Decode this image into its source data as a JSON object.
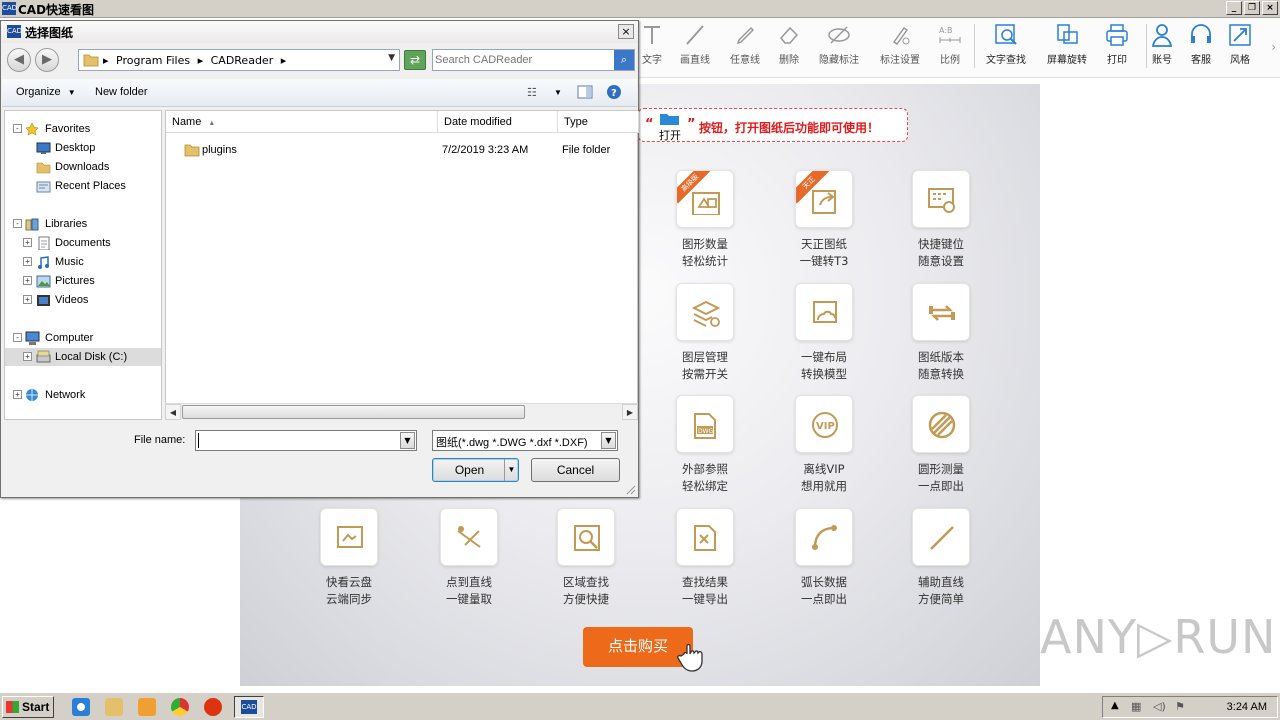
{
  "app": {
    "title": "CAD快速看图",
    "icon_label": "CAD"
  },
  "window_controls": {
    "minimize": "_",
    "restore": "❐",
    "close": "×"
  },
  "toolbar": [
    {
      "label": "文字",
      "icon": "text-icon"
    },
    {
      "label": "画直线",
      "icon": "line-icon"
    },
    {
      "label": "任意线",
      "icon": "pen-icon"
    },
    {
      "label": "删除",
      "icon": "eraser-icon"
    },
    {
      "label": "隐藏标注",
      "icon": "eye-hide-icon"
    },
    {
      "label": "标注设置",
      "icon": "annotation-settings-icon"
    },
    {
      "label": "比例",
      "icon": "scale-icon"
    },
    {
      "label": "文字查找",
      "icon": "text-search-icon"
    },
    {
      "label": "屏幕旋转",
      "icon": "screen-rotate-icon"
    },
    {
      "label": "打印",
      "icon": "printer-icon"
    },
    {
      "label": "账号",
      "icon": "account-icon"
    },
    {
      "label": "客服",
      "icon": "headset-icon"
    },
    {
      "label": "风格",
      "icon": "style-icon"
    }
  ],
  "hint": {
    "quote_open": "“",
    "quote_close": "”",
    "open_label": "打开",
    "text": "按钮，打开图纸后功能即可使用！"
  },
  "features": [
    {
      "line1": "图形数量",
      "line2": "轻松统计",
      "badge": "高级版",
      "icon": "shape-count-icon"
    },
    {
      "line1": "天正图纸",
      "line2": "一键转T3",
      "badge": "天正",
      "icon": "export-t3-icon"
    },
    {
      "line1": "快捷键位",
      "line2": "随意设置",
      "icon": "keyboard-settings-icon"
    },
    {
      "line1": "图层管理",
      "line2": "按需开关",
      "icon": "layers-icon"
    },
    {
      "line1": "一键布局",
      "line2": "转换模型",
      "icon": "layout-convert-icon"
    },
    {
      "line1": "图纸版本",
      "line2": "随意转换",
      "icon": "version-convert-icon"
    },
    {
      "line1": "外部参照",
      "line2": "轻松绑定",
      "icon": "dwg-xref-icon"
    },
    {
      "line1": "离线VIP",
      "line2": "想用就用",
      "icon": "vip-icon"
    },
    {
      "line1": "圆形测量",
      "line2": "一点即出",
      "icon": "circle-measure-icon"
    },
    {
      "line1": "快看云盘",
      "line2": "云端同步",
      "icon": "cloud-sync-icon"
    },
    {
      "line1": "点到直线",
      "line2": "一键量取",
      "icon": "point-to-line-icon"
    },
    {
      "line1": "区域查找",
      "line2": "方便快捷",
      "icon": "area-search-icon"
    },
    {
      "line1": "查找结果",
      "line2": "一键导出",
      "icon": "export-results-icon"
    },
    {
      "line1": "弧长数据",
      "line2": "一点即出",
      "icon": "arc-length-icon"
    },
    {
      "line1": "辅助直线",
      "line2": "方便简单",
      "icon": "helper-line-icon"
    }
  ],
  "buy_button": "点击购买",
  "watermark": "ANY▷RUN",
  "dialog": {
    "title": "选择图纸",
    "close": "×",
    "breadcrumb": [
      "Program Files",
      "CADReader"
    ],
    "search_placeholder": "Search CADReader",
    "organize": "Organize",
    "new_folder": "New folder",
    "tree": [
      {
        "label": "Favorites",
        "level": 0,
        "expander": "-",
        "icon": "star-icon"
      },
      {
        "label": "Desktop",
        "level": 1,
        "icon": "desktop-icon"
      },
      {
        "label": "Downloads",
        "level": 1,
        "icon": "downloads-icon"
      },
      {
        "label": "Recent Places",
        "level": 1,
        "icon": "recent-places-icon"
      },
      {
        "label": "Libraries",
        "level": 0,
        "expander": "-",
        "icon": "library-icon"
      },
      {
        "label": "Documents",
        "level": 1,
        "expander": "+",
        "icon": "documents-icon"
      },
      {
        "label": "Music",
        "level": 1,
        "expander": "+",
        "icon": "music-icon"
      },
      {
        "label": "Pictures",
        "level": 1,
        "expander": "+",
        "icon": "pictures-icon"
      },
      {
        "label": "Videos",
        "level": 1,
        "expander": "+",
        "icon": "videos-icon"
      },
      {
        "label": "Computer",
        "level": 0,
        "expander": "-",
        "icon": "computer-icon"
      },
      {
        "label": "Local Disk (C:)",
        "level": 1,
        "expander": "+",
        "icon": "disk-icon",
        "selected": true
      },
      {
        "label": "Network",
        "level": 0,
        "expander": "+",
        "icon": "network-icon"
      }
    ],
    "columns": [
      "Name",
      "Date modified",
      "Type"
    ],
    "files": [
      {
        "name": "plugins",
        "date": "7/2/2019 3:23 AM",
        "type": "File folder"
      }
    ],
    "file_name_label": "File name:",
    "file_name_value": "",
    "filter": "图纸(*.dwg *.DWG *.dxf *.DXF)",
    "open": "Open",
    "cancel": "Cancel"
  },
  "taskbar": {
    "start": "Start",
    "clock": "3:24 AM",
    "apps": [
      "ie-icon",
      "explorer-icon",
      "media-player-icon",
      "chrome-icon",
      "opera-icon",
      "cad-reader-icon"
    ]
  },
  "colors": {
    "accent_orange": "#ed6a1a",
    "icon_gold": "#c29a55",
    "hint_red": "#e01b1b"
  }
}
